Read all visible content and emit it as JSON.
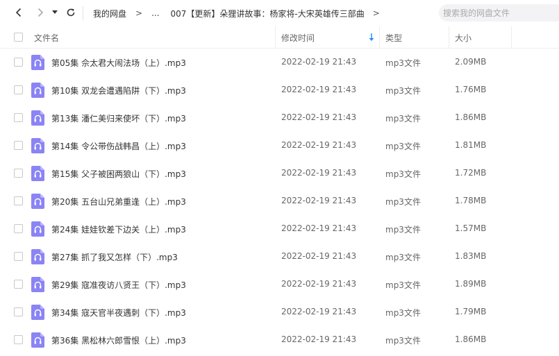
{
  "toolbar": {
    "back_icon": "chevron-left-icon",
    "forward_icon": "chevron-right-icon",
    "history_icon": "caret-down-icon",
    "refresh_icon": "refresh-icon",
    "breadcrumb": {
      "root": "我的网盘",
      "separator": ">",
      "ellipsis": "...",
      "current": "007【更新】朵狸讲故事：杨家将-大宋英雄传三部曲"
    },
    "search_placeholder": "搜索我的网盘文件"
  },
  "columns": {
    "name": "文件名",
    "modified": "修改时间",
    "type": "类型",
    "size": "大小",
    "sort_indicator": "arrow-down-icon",
    "sort_color": "#1e90ff"
  },
  "files": [
    {
      "name": "第05集 佘太君大闹法场（上）.mp3",
      "modified": "2022-02-19 21:43",
      "type": "mp3文件",
      "size": "2.09MB"
    },
    {
      "name": "第10集 双龙会遭遇陷阱（下）.mp3",
      "modified": "2022-02-19 21:43",
      "type": "mp3文件",
      "size": "1.76MB"
    },
    {
      "name": "第13集 潘仁美归来使坏（下）.mp3",
      "modified": "2022-02-19 21:43",
      "type": "mp3文件",
      "size": "1.86MB"
    },
    {
      "name": "第14集 令公带伤战韩昌（上）.mp3",
      "modified": "2022-02-19 21:43",
      "type": "mp3文件",
      "size": "1.81MB"
    },
    {
      "name": "第15集 父子被困两狼山（下）.mp3",
      "modified": "2022-02-19 21:43",
      "type": "mp3文件",
      "size": "1.72MB"
    },
    {
      "name": "第20集 五台山兄弟重逢（上）.mp3",
      "modified": "2022-02-19 21:43",
      "type": "mp3文件",
      "size": "1.78MB"
    },
    {
      "name": "第24集 娃娃钦差下边关（上）.mp3",
      "modified": "2022-02-19 21:43",
      "type": "mp3文件",
      "size": "1.57MB"
    },
    {
      "name": "第27集 抓了我又怎样（下）.mp3",
      "modified": "2022-02-19 21:43",
      "type": "mp3文件",
      "size": "1.83MB"
    },
    {
      "name": "第29集 寇准夜访八贤王（下）.mp3",
      "modified": "2022-02-19 21:43",
      "type": "mp3文件",
      "size": "1.89MB"
    },
    {
      "name": "第34集 寇天官半夜遇刺（下）.mp3",
      "modified": "2022-02-19 21:43",
      "type": "mp3文件",
      "size": "1.79MB"
    },
    {
      "name": "第36集 黑松林六郎雪恨（上）.mp3",
      "modified": "2022-02-19 21:43",
      "type": "mp3文件",
      "size": "1.86MB"
    }
  ],
  "file_icon": "audio-file-icon",
  "file_icon_color": "#8b84f4"
}
